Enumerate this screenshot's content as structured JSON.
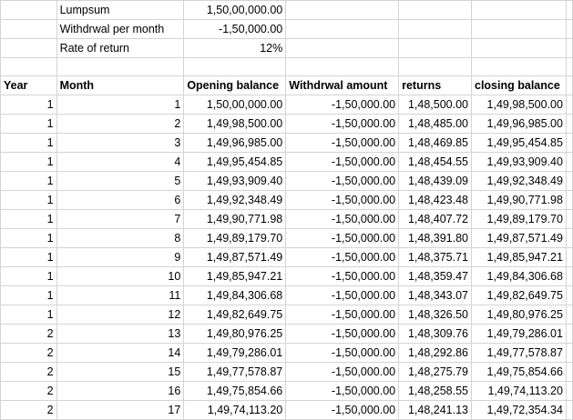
{
  "inputs": [
    {
      "label": "Lumpsum",
      "value": "1,50,00,000.00"
    },
    {
      "label": "Withdrwal per month",
      "value": "-1,50,000.00"
    },
    {
      "label": "Rate of return",
      "value": "12%"
    }
  ],
  "headers": [
    "Year",
    "Month",
    "Opening balance",
    "Withdrwal amount",
    "returns",
    "closing balance"
  ],
  "rows": [
    [
      "1",
      "1",
      "1,50,00,000.00",
      "-1,50,000.00",
      "1,48,500.00",
      "1,49,98,500.00"
    ],
    [
      "1",
      "2",
      "1,49,98,500.00",
      "-1,50,000.00",
      "1,48,485.00",
      "1,49,96,985.00"
    ],
    [
      "1",
      "3",
      "1,49,96,985.00",
      "-1,50,000.00",
      "1,48,469.85",
      "1,49,95,454.85"
    ],
    [
      "1",
      "4",
      "1,49,95,454.85",
      "-1,50,000.00",
      "1,48,454.55",
      "1,49,93,909.40"
    ],
    [
      "1",
      "5",
      "1,49,93,909.40",
      "-1,50,000.00",
      "1,48,439.09",
      "1,49,92,348.49"
    ],
    [
      "1",
      "6",
      "1,49,92,348.49",
      "-1,50,000.00",
      "1,48,423.48",
      "1,49,90,771.98"
    ],
    [
      "1",
      "7",
      "1,49,90,771.98",
      "-1,50,000.00",
      "1,48,407.72",
      "1,49,89,179.70"
    ],
    [
      "1",
      "8",
      "1,49,89,179.70",
      "-1,50,000.00",
      "1,48,391.80",
      "1,49,87,571.49"
    ],
    [
      "1",
      "9",
      "1,49,87,571.49",
      "-1,50,000.00",
      "1,48,375.71",
      "1,49,85,947.21"
    ],
    [
      "1",
      "10",
      "1,49,85,947.21",
      "-1,50,000.00",
      "1,48,359.47",
      "1,49,84,306.68"
    ],
    [
      "1",
      "11",
      "1,49,84,306.68",
      "-1,50,000.00",
      "1,48,343.07",
      "1,49,82,649.75"
    ],
    [
      "1",
      "12",
      "1,49,82,649.75",
      "-1,50,000.00",
      "1,48,326.50",
      "1,49,80,976.25"
    ],
    [
      "2",
      "13",
      "1,49,80,976.25",
      "-1,50,000.00",
      "1,48,309.76",
      "1,49,79,286.01"
    ],
    [
      "2",
      "14",
      "1,49,79,286.01",
      "-1,50,000.00",
      "1,48,292.86",
      "1,49,77,578.87"
    ],
    [
      "2",
      "15",
      "1,49,77,578.87",
      "-1,50,000.00",
      "1,48,275.79",
      "1,49,75,854.66"
    ],
    [
      "2",
      "16",
      "1,49,75,854.66",
      "-1,50,000.00",
      "1,48,258.55",
      "1,49,74,113.20"
    ],
    [
      "2",
      "17",
      "1,49,74,113.20",
      "-1,50,000.00",
      "1,48,241.13",
      "1,49,72,354.34"
    ]
  ]
}
